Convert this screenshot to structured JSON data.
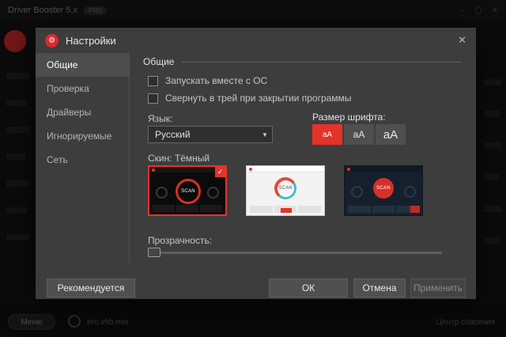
{
  "background": {
    "title": "Driver Booster 5.x",
    "title_badge": "PRO",
    "win_minimize": "–",
    "win_maximize": "▢",
    "win_close": "✕",
    "bottom_button": "Меню",
    "bottom_info": "ero.vhb.mor",
    "bottom_right": "Центр спасения"
  },
  "dialog": {
    "logo_glyph": "⚙",
    "title": "Настройки",
    "close": "✕",
    "sidebar": [
      {
        "label": "Общие"
      },
      {
        "label": "Проверка"
      },
      {
        "label": "Драйверы"
      },
      {
        "label": "Игнорируемые"
      },
      {
        "label": "Сеть"
      }
    ],
    "general": {
      "section": "Общие",
      "autostart": "Запускать вместе с ОС",
      "tray": "Свернуть в трей при закрытии программы",
      "language_label": "Язык:",
      "language_value": "Русский",
      "dropdown_arrow": "▼",
      "font_label": "Размер шрифта:",
      "font_small": "аА",
      "font_medium": "аА",
      "font_large": "аА",
      "skin_label": "Скин: Тёмный",
      "scan": "SCAN",
      "check": "✓",
      "transparency_label": "Прозрачность:"
    },
    "footer": {
      "recommended": "Рекомендуется",
      "ok": "ОК",
      "cancel": "Отмена",
      "apply": "Применить"
    }
  },
  "colors": {
    "accent": "#e6332a",
    "dialog_bg": "#3d3d3d",
    "app_bg": "#141414"
  }
}
